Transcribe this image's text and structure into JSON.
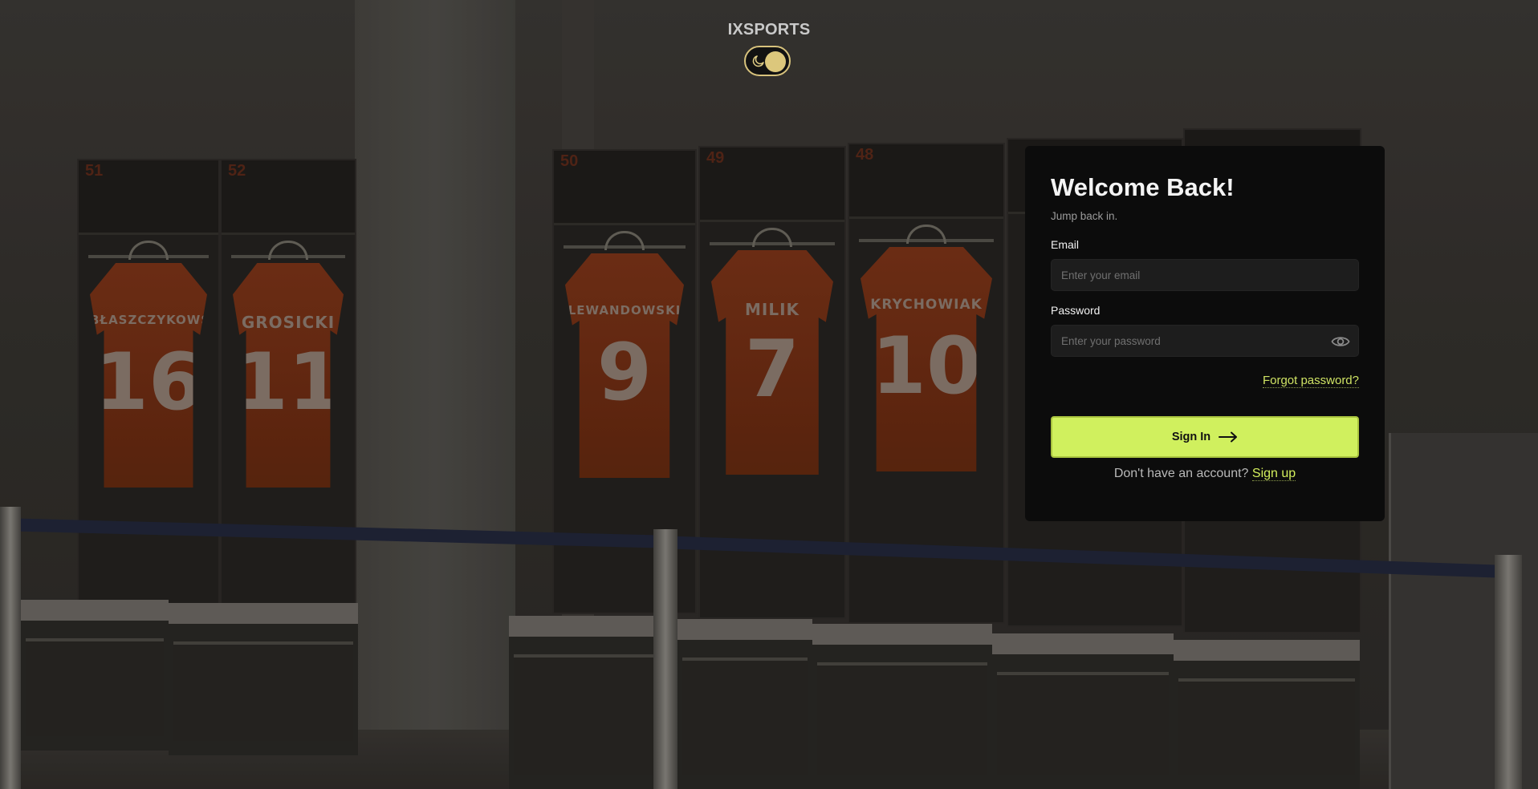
{
  "brand": {
    "name": "IXSPORTS"
  },
  "theme_toggle": {
    "icon": "moon-icon",
    "state": "dark"
  },
  "background": {
    "locker_numbers": [
      "51",
      "52",
      "50",
      "49",
      "48"
    ],
    "jerseys": [
      {
        "name": "BŁASZCZYKOWSKI",
        "number": "16"
      },
      {
        "name": "GROSICKI",
        "number": "11"
      },
      {
        "name": "LEWANDOWSKI",
        "number": "9"
      },
      {
        "name": "MILIK",
        "number": "7"
      },
      {
        "name": "KRYCHOWIAK",
        "number": "10"
      }
    ]
  },
  "login": {
    "title": "Welcome Back!",
    "subtitle": "Jump back in.",
    "email_label": "Email",
    "email_placeholder": "Enter your email",
    "email_value": "",
    "password_label": "Password",
    "password_placeholder": "Enter your password",
    "password_value": "",
    "password_toggle_icon": "eye-icon",
    "forgot_password": "Forgot password?",
    "sign_in_label": "Sign In",
    "sign_in_icon": "arrow-right-icon",
    "no_account_text": "Don't have an account?",
    "sign_up_link": "Sign up"
  },
  "colors": {
    "accent": "#d0f05e",
    "toggle_accent": "#dcc77c",
    "card_bg": "#0c0c0c"
  }
}
